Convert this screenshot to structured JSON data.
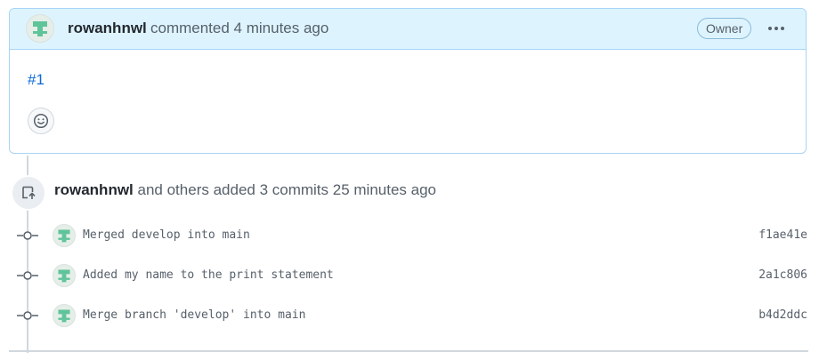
{
  "comment": {
    "author": "rowanhnwl",
    "meta": "commented 4 minutes ago",
    "badge": "Owner",
    "body_link": "#1"
  },
  "commits_event": {
    "author": "rowanhnwl",
    "text": "and others added 3 commits 25 minutes ago",
    "commits": [
      {
        "message": "Merged develop into main",
        "sha": "f1ae41e"
      },
      {
        "message": "Added my name to the print statement",
        "sha": "2a1c806"
      },
      {
        "message": "Merge branch 'develop' into main",
        "sha": "b4d2ddc"
      }
    ]
  },
  "colors": {
    "header_bg": "#ddf4ff",
    "link": "#0969da",
    "avatar_green": "#5fc49a"
  },
  "icons": [
    "kebab-icon",
    "smiley-icon",
    "repo-push-icon",
    "git-commit-icon"
  ]
}
